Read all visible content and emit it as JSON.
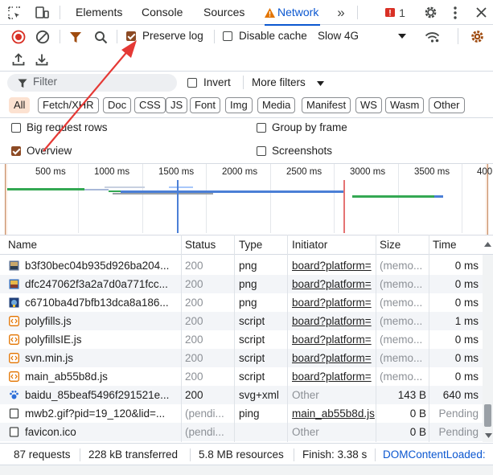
{
  "tabbar": {
    "tabs": [
      {
        "label": "Elements"
      },
      {
        "label": "Console"
      },
      {
        "label": "Sources"
      },
      {
        "label": "Network"
      }
    ],
    "issues_count": "1"
  },
  "toolbar": {
    "preserve_log_label": "Preserve log",
    "preserve_log_checked": true,
    "disable_cache_label": "Disable cache",
    "disable_cache_checked": false,
    "throttling_value": "Slow 4G"
  },
  "filterbar": {
    "filter_placeholder": "Filter",
    "invert_label": "Invert",
    "more_filters_label": "More filters"
  },
  "chips": [
    "All",
    "Fetch/XHR",
    "Doc",
    "CSS",
    "JS",
    "Font",
    "Img",
    "Media",
    "Manifest",
    "WS",
    "Wasm",
    "Other"
  ],
  "options": {
    "big_request_rows": "Big request rows",
    "group_by_frame": "Group by frame",
    "overview": "Overview",
    "screenshots": "Screenshots"
  },
  "timeline": {
    "ticks": [
      "500 ms",
      "1000 ms",
      "1500 ms",
      "2000 ms",
      "2500 ms",
      "3000 ms",
      "3500 ms",
      "400"
    ]
  },
  "table": {
    "columns": [
      "Name",
      "Status",
      "Type",
      "Initiator",
      "Size",
      "Time"
    ],
    "rows": [
      {
        "icon": "image-icon",
        "name": "b3f30bec04b935d926ba204...",
        "status": "200",
        "type": "png",
        "initiator": "board?platform=",
        "size": "(memo...",
        "time": "0 ms"
      },
      {
        "icon": "image-icon",
        "name": "dfc247062f3a2a7d0a771fcc...",
        "status": "200",
        "type": "png",
        "initiator": "board?platform=",
        "size": "(memo...",
        "time": "0 ms"
      },
      {
        "icon": "image-icon",
        "name": "c6710ba4d7bfb13dca8a186...",
        "status": "200",
        "type": "png",
        "initiator": "board?platform=",
        "size": "(memo...",
        "time": "0 ms"
      },
      {
        "icon": "script-icon",
        "name": "polyfills.js",
        "status": "200",
        "type": "script",
        "initiator": "board?platform=",
        "size": "(memo...",
        "time": "1 ms"
      },
      {
        "icon": "script-icon",
        "name": "polyfillsIE.js",
        "status": "200",
        "type": "script",
        "initiator": "board?platform=",
        "size": "(memo...",
        "time": "0 ms"
      },
      {
        "icon": "script-icon",
        "name": "svn.min.js",
        "status": "200",
        "type": "script",
        "initiator": "board?platform=",
        "size": "(memo...",
        "time": "0 ms"
      },
      {
        "icon": "script-icon",
        "name": "main_ab55b8d.js",
        "status": "200",
        "type": "script",
        "initiator": "board?platform=",
        "size": "(memo...",
        "time": "0 ms"
      },
      {
        "icon": "svg-paw-icon",
        "name": "baidu_85beaf5496f291521e...",
        "status": "200",
        "type": "svg+xml",
        "initiator": "Other",
        "size": "143 B",
        "time": "640 ms"
      },
      {
        "icon": "document-icon",
        "name": "mwb2.gif?pid=19_120&lid=...",
        "status": "(pendi...",
        "type": "ping",
        "initiator": "main_ab55b8d.js",
        "size": "0 B",
        "time": "Pending"
      },
      {
        "icon": "document-icon",
        "name": "favicon.ico",
        "status": "(pendi...",
        "type": "",
        "initiator": "Other",
        "size": "0 B",
        "time": "Pending"
      }
    ]
  },
  "statusbar": {
    "requests": "87 requests",
    "transferred": "228 kB transferred",
    "resources": "5.8 MB resources",
    "finish": "Finish: 3.38 s",
    "dcl": "DOMContentLoaded:"
  },
  "colors": {
    "accent": "#0b57d0",
    "record_red": "#d93025",
    "checkbox_brown": "#8c4a24",
    "chip_selected_bg": "#fce2d1",
    "annotation_arrow": "#e53935"
  }
}
